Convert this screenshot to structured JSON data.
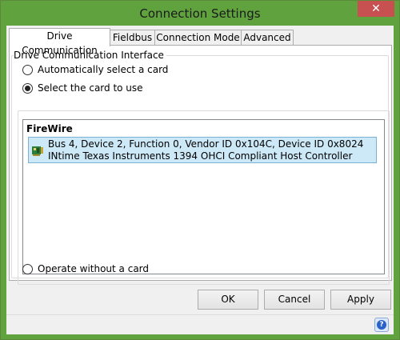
{
  "window": {
    "title": "Connection Settings",
    "close_symbol": "✕"
  },
  "tabs": [
    {
      "label": "Drive Communication",
      "active": true
    },
    {
      "label": "Fieldbus",
      "active": false
    },
    {
      "label": "Connection Mode",
      "active": false
    },
    {
      "label": "Advanced",
      "active": false
    }
  ],
  "group": {
    "label": "Drive Communication Interface",
    "radio_auto": "Automatically select a card",
    "radio_select": "Select the card to use",
    "radio_none": "Operate without a card",
    "selected": "radio_select"
  },
  "card_list": {
    "header": "FireWire",
    "items": [
      {
        "line1": "Bus 4, Device 2, Function 0, Vendor ID 0x104C, Device ID 0x8024",
        "line2": "INtime Texas Instruments 1394 OHCI Compliant Host Controller",
        "selected": true,
        "icon": "network-card-icon"
      }
    ]
  },
  "buttons": {
    "ok": "OK",
    "cancel": "Cancel",
    "apply": "Apply"
  },
  "help": {
    "icon": "help-icon",
    "symbol": "?"
  },
  "colors": {
    "title_bar": "#5fa23e",
    "selection": "#cde8f7",
    "close": "#c75050"
  }
}
